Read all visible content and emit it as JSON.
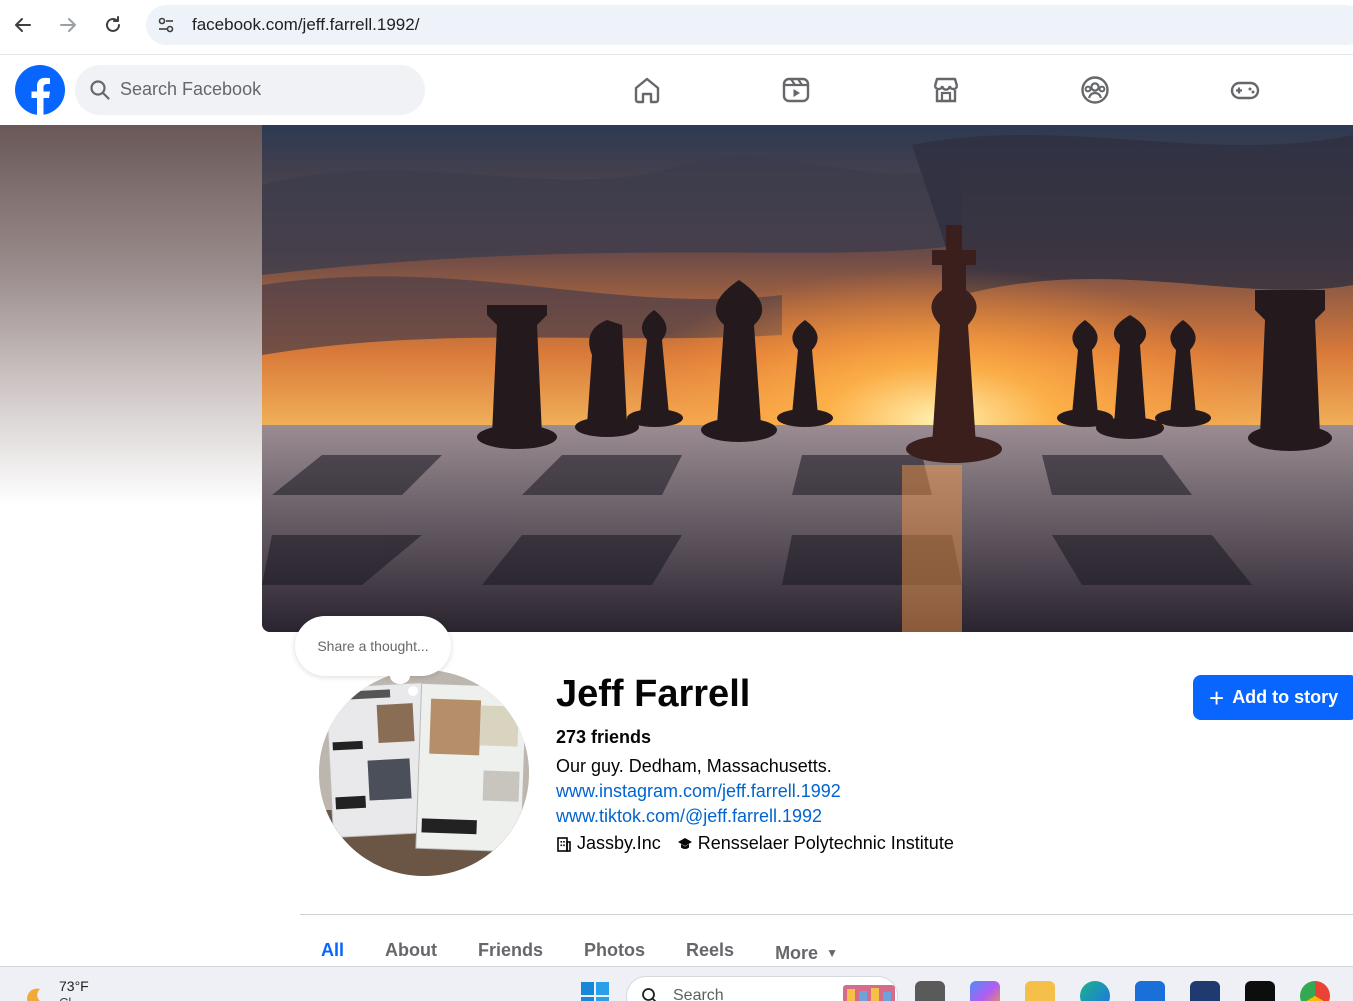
{
  "browser": {
    "url": "facebook.com/jeff.farrell.1992/",
    "back_icon": "arrow-left-icon",
    "forward_icon": "arrow-right-icon",
    "reload_icon": "reload-icon"
  },
  "header": {
    "search_placeholder": "Search Facebook",
    "nav": [
      "home-icon",
      "reels-icon",
      "marketplace-icon",
      "groups-icon",
      "gaming-icon"
    ]
  },
  "profile": {
    "thought_prompt": "Share a thought...",
    "name": "Jeff Farrell",
    "friends": "273 friends",
    "bio": "Our guy. Dedham, Massachusetts.",
    "links": [
      "www.instagram.com/jeff.farrell.1992",
      "www.tiktok.com/@jeff.farrell.1992"
    ],
    "work": "Jassby.Inc",
    "education": "Rensselaer Polytechnic Institute",
    "add_story_label": "Add to story"
  },
  "tabs": [
    {
      "label": "All",
      "active": true
    },
    {
      "label": "About"
    },
    {
      "label": "Friends"
    },
    {
      "label": "Photos"
    },
    {
      "label": "Reels"
    },
    {
      "label": "More"
    }
  ],
  "taskbar": {
    "temperature": "73°F",
    "condition": "Cl",
    "search_label": "Search"
  },
  "colors": {
    "brand_blue": "#0866ff",
    "link_blue": "#0064d1"
  }
}
